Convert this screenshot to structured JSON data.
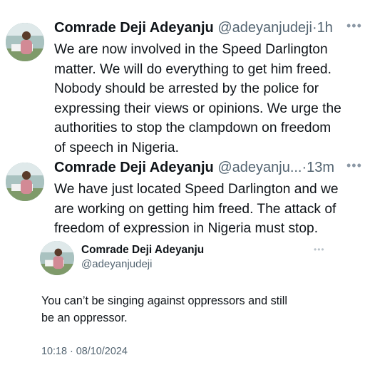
{
  "tweet1": {
    "author_name": "Comrade Deji Adeyanju",
    "handle": "@adeyanjudeji",
    "separator": "·",
    "time": "1h",
    "more_icon": "ellipsis-icon",
    "text_lines": [
      "We are now involved in the Speed Darlington",
      "matter. We will do everything to get him freed.",
      "Nobody should be arrested by the police for",
      "expressing their views or opinions. We urge the",
      "authorities to stop the clampdown on freedom",
      "of speech in Nigeria."
    ]
  },
  "tweet2": {
    "author_name": "Comrade Deji Adeyanju",
    "handle": "@adeyanju...",
    "separator": "·",
    "time": "13m",
    "more_icon": "ellipsis-icon",
    "text_lines": [
      "We have just located Speed Darlington and we",
      "are working on getting him freed. The attack of",
      "freedom of expression in Nigeria must stop."
    ]
  },
  "quoted_tweet": {
    "author_name": "Comrade Deji Adeyanju",
    "handle": "@adeyanjudeji",
    "more_icon": "ellipsis-icon",
    "text_lines": [
      "You can’t be singing against oppressors and still",
      "be an oppressor."
    ],
    "timestamp": "10:18 · 08/10/2024"
  }
}
